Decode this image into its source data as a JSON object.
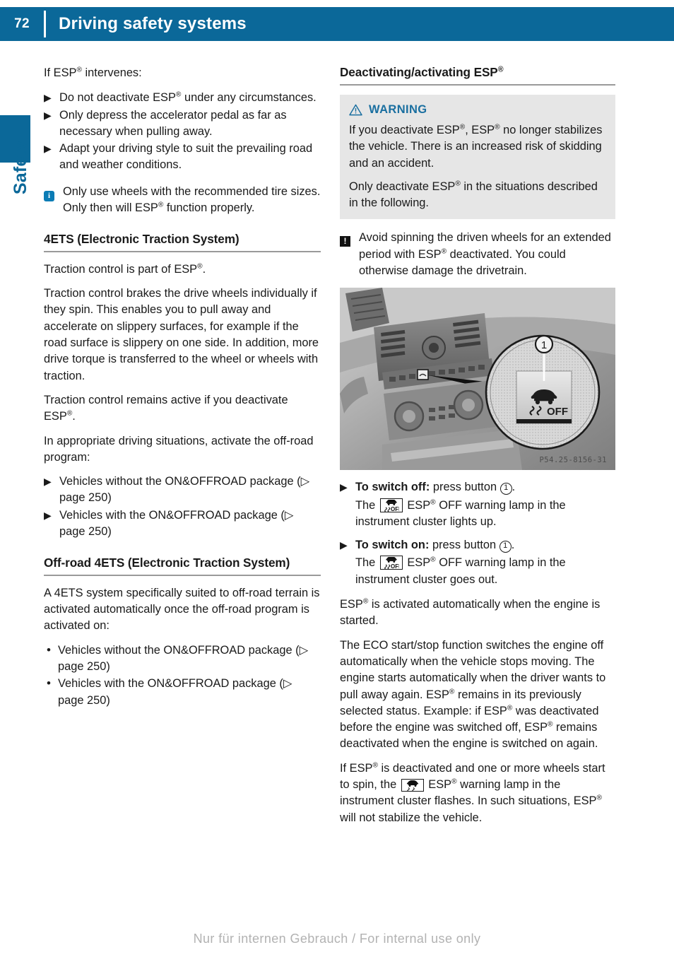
{
  "header": {
    "page_number": "72",
    "title": "Driving safety systems"
  },
  "side_tab": {
    "label": "Safety"
  },
  "colors": {
    "brand_blue": "#0b6899",
    "warning_blue": "#1a6fa0",
    "warning_box_bg": "#e6e6e6",
    "rule_gray": "#9a9a9a",
    "footer_gray": "#b2b2b2"
  },
  "left_column": {
    "intro": "If ESP® intervenes:",
    "bullets": [
      "Do not deactivate ESP® under any circumstances.",
      "Only depress the accelerator pedal as far as necessary when pulling away.",
      "Adapt your driving style to suit the prevailing road and weather conditions."
    ],
    "info_note": "Only use wheels with the recommended tire sizes. Only then will ESP® function properly.",
    "section_4ets": {
      "heading": "4ETS (Electronic Traction System)",
      "paragraphs": [
        "Traction control is part of ESP®.",
        "Traction control brakes the drive wheels individually if they spin. This enables you to pull away and accelerate on slippery surfaces, for example if the road surface is slippery on one side. In addition, more drive torque is transferred to the wheel or wheels with traction.",
        "Traction control remains active if you deactivate ESP®.",
        "In appropriate driving situations, activate the off-road program:"
      ],
      "bullets": [
        "Vehicles without the ON&OFFROAD package (▷ page 250)",
        "Vehicles with the ON&OFFROAD package (▷ page 250)"
      ]
    },
    "section_offroad_4ets": {
      "heading": "Off-road 4ETS (Electronic Traction System)",
      "paragraphs": [
        "A 4ETS system specifically suited to off-road terrain is activated automatically once the off-road program is activated on:"
      ],
      "bullets": [
        "Vehicles without the ON&OFFROAD package (▷ page 250)",
        "Vehicles with the ON&OFFROAD package (▷ page 250)"
      ]
    }
  },
  "right_column": {
    "heading": "Deactivating/activating ESP®",
    "warning": {
      "label": "WARNING",
      "paragraphs": [
        "If you deactivate ESP®, ESP® no longer stabilizes the vehicle. There is an increased risk of skidding and an accident.",
        "Only deactivate ESP® in the situations described in the following."
      ]
    },
    "caution": "Avoid spinning the driven wheels for an extended period with ESP® deactivated. You could otherwise damage the drivetrain.",
    "figure": {
      "code": "P54.25-8156-31",
      "callout_number": "1",
      "magnifier_label": "OFF"
    },
    "steps": [
      {
        "bold": "To switch off:",
        "rest": " press button",
        "callout": "1",
        "tail": ".",
        "detail_prefix": "The",
        "detail_suffix": "ESP® OFF warning lamp in the instrument cluster lights up."
      },
      {
        "bold": "To switch on:",
        "rest": " press button",
        "callout": "1",
        "tail": ".",
        "detail_prefix": "The",
        "detail_suffix": "ESP® OFF warning lamp in the instrument cluster goes out."
      }
    ],
    "paragraphs": [
      "ESP® is activated automatically when the engine is started.",
      "The ECO start/stop function switches the engine off automatically when the vehicle stops moving. The engine starts automatically when the driver wants to pull away again. ESP® remains in its previously selected status. Example: if ESP® was deactivated before the engine was switched off, ESP® remains deactivated when the engine is switched on again."
    ],
    "final_paragraph": {
      "prefix": "If ESP® is deactivated and one or more wheels start to spin, the",
      "suffix": "ESP® warning lamp in the instrument cluster flashes. In such situations, ESP® will not stabilize the vehicle."
    },
    "lamp_icon_off_label": "OFF"
  },
  "footer": {
    "watermark": "Nur für internen Gebrauch / For internal use only"
  }
}
